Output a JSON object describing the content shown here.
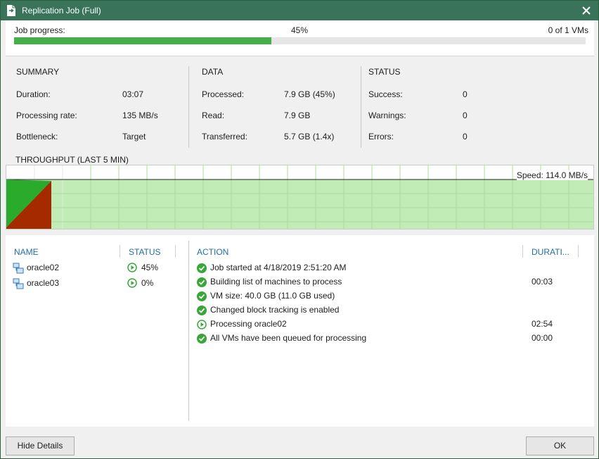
{
  "window": {
    "title": "Replication Job (Full)",
    "title_icon": "document-arrow-icon",
    "close_icon": "close-icon",
    "accent_color": "#38735a"
  },
  "progress": {
    "label": "Job progress:",
    "percent_text": "45%",
    "fraction": 0.45,
    "count_text": "0 of 1 VMs",
    "fill_color": "#43b049"
  },
  "summary": {
    "heading": "SUMMARY",
    "rows": [
      {
        "label": "Duration:",
        "value": "03:07"
      },
      {
        "label": "Processing rate:",
        "value": "135 MB/s"
      },
      {
        "label": "Bottleneck:",
        "value": "Target"
      }
    ]
  },
  "data_section": {
    "heading": "DATA",
    "rows": [
      {
        "label": "Processed:",
        "value": "7.9 GB (45%)"
      },
      {
        "label": "Read:",
        "value": "7.9 GB"
      },
      {
        "label": "Transferred:",
        "value": "5.7 GB (1.4x)"
      }
    ]
  },
  "status_section": {
    "heading": "STATUS",
    "rows": [
      {
        "label": "Success:",
        "value": "0"
      },
      {
        "label": "Warnings:",
        "value": "0"
      },
      {
        "label": "Errors:",
        "value": "0"
      }
    ]
  },
  "throughput": {
    "label": "THROUGHPUT (LAST 5 MIN)",
    "speed_text": "Speed: 114.0 MB/s",
    "colors": {
      "area": "#c1ecb5",
      "grid": "#a9dc9c",
      "processed": "#2bab2b",
      "read": "#a52a00"
    }
  },
  "vm_table": {
    "headers": {
      "name": "NAME",
      "status": "STATUS"
    },
    "rows": [
      {
        "name": "oracle02",
        "status": "45%",
        "icon": "vm-icon",
        "status_icon": "play-icon"
      },
      {
        "name": "oracle03",
        "status": "0%",
        "icon": "vm-icon",
        "status_icon": "play-icon"
      }
    ]
  },
  "action_log": {
    "headers": {
      "action": "ACTION",
      "duration": "DURATI..."
    },
    "rows": [
      {
        "icon": "check-icon",
        "text": "Job started at 4/18/2019 2:51:20 AM",
        "duration": ""
      },
      {
        "icon": "check-icon",
        "text": "Building list of machines to process",
        "duration": "00:03"
      },
      {
        "icon": "check-icon",
        "text": "VM size: 40.0 GB (11.0 GB used)",
        "duration": ""
      },
      {
        "icon": "check-icon",
        "text": "Changed block tracking is enabled",
        "duration": ""
      },
      {
        "icon": "play-icon",
        "text": "Processing oracle02",
        "duration": "02:54"
      },
      {
        "icon": "check-icon",
        "text": "All VMs have been queued for processing",
        "duration": "00:00"
      }
    ]
  },
  "buttons": {
    "hide_details": "Hide Details",
    "ok": "OK"
  }
}
